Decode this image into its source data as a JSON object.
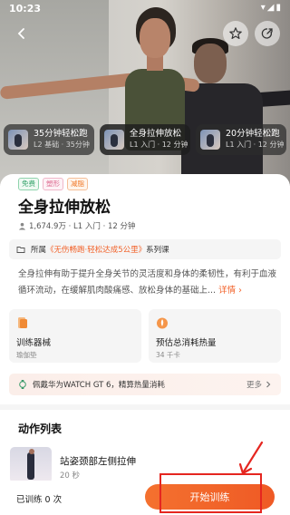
{
  "status_bar": {
    "time": "10:23",
    "icons": "▾◢▮"
  },
  "related_courses": [
    {
      "title": "35分钟轻松跑",
      "subtitle": "L2 基础 · 35分钟"
    },
    {
      "title": "全身拉伸放松",
      "subtitle": "L1 入门 · 12 分钟"
    },
    {
      "title": "20分钟轻松跑",
      "subtitle": "L1 入门 · 12 分钟"
    }
  ],
  "tags": [
    "免费",
    "塑形",
    "减脂"
  ],
  "course": {
    "title": "全身拉伸放松",
    "meta": "1,674.9万 · L1 入门 · 12 分钟",
    "series_prefix": "所属",
    "series_name": "《无伤畅跑·轻松达成5公里》",
    "series_suffix": "系列课",
    "description": "全身拉伸有助于提升全身关节的灵活度和身体的柔韧性，有利于血液循环流动，在缓解肌肉酸痛感、放松身体的基础上...",
    "description_more": "详情"
  },
  "info_cards": [
    {
      "label": "训练器械",
      "value": "瑜伽垫"
    },
    {
      "label": "预估总消耗热量",
      "value": "34 千卡"
    }
  ],
  "watch_banner": {
    "text": "佩戴华为WATCH GT 6，精算热量消耗",
    "more": "更多"
  },
  "section_title": "动作列表",
  "exercise": {
    "name": "站姿颈部左侧拉伸",
    "duration": "20 秒"
  },
  "bottom_bar": {
    "trained": "已训练 0 次",
    "start_label": "开始训练"
  },
  "colors": {
    "accent": "#f2632b",
    "annotation": "#e52620"
  }
}
